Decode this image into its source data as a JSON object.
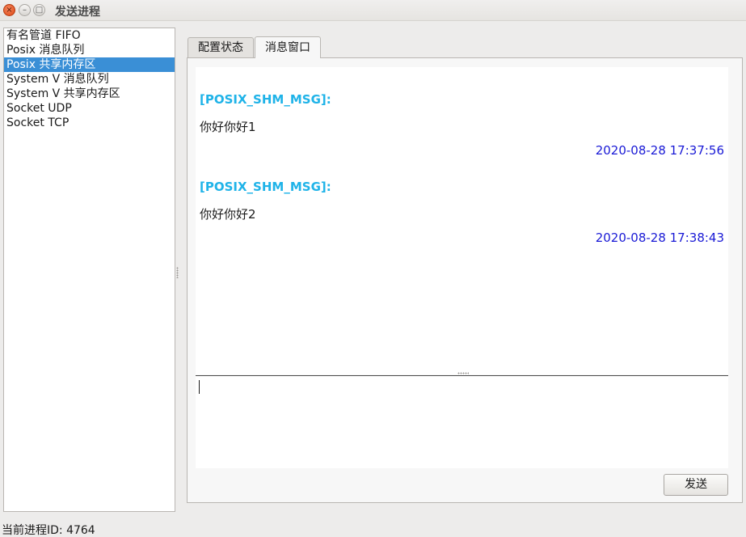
{
  "window": {
    "title": "发送进程",
    "close_glyph": "×",
    "min_glyph": "–",
    "max_glyph": "□"
  },
  "ipc_list": {
    "items": [
      {
        "label": "有名管道 FIFO",
        "selected": false
      },
      {
        "label": "Posix 消息队列",
        "selected": false
      },
      {
        "label": "Posix 共享内存区",
        "selected": true
      },
      {
        "label": "System V 消息队列",
        "selected": false
      },
      {
        "label": "System V 共享内存区",
        "selected": false
      },
      {
        "label": "Socket UDP",
        "selected": false
      },
      {
        "label": "Socket TCP",
        "selected": false
      }
    ]
  },
  "tabs": [
    {
      "label": "配置状态",
      "active": false
    },
    {
      "label": "消息窗口",
      "active": true
    }
  ],
  "messages": [
    {
      "tag": "[POSIX_SHM_MSG]:",
      "body": "你好你好1",
      "time": "2020-08-28 17:37:56"
    },
    {
      "tag": "[POSIX_SHM_MSG]:",
      "body": "你好你好2",
      "time": "2020-08-28 17:38:43"
    }
  ],
  "input": {
    "value": ""
  },
  "send_button": {
    "label": "发送"
  },
  "status": {
    "text": "当前进程ID: 4764"
  },
  "colors": {
    "selection": "#3a8fd6",
    "msg_tag": "#1fb3e8",
    "msg_time": "#1a1ad6",
    "close_button": "#dd4814"
  },
  "icons": [
    "close-icon",
    "minimize-icon",
    "maximize-icon"
  ]
}
